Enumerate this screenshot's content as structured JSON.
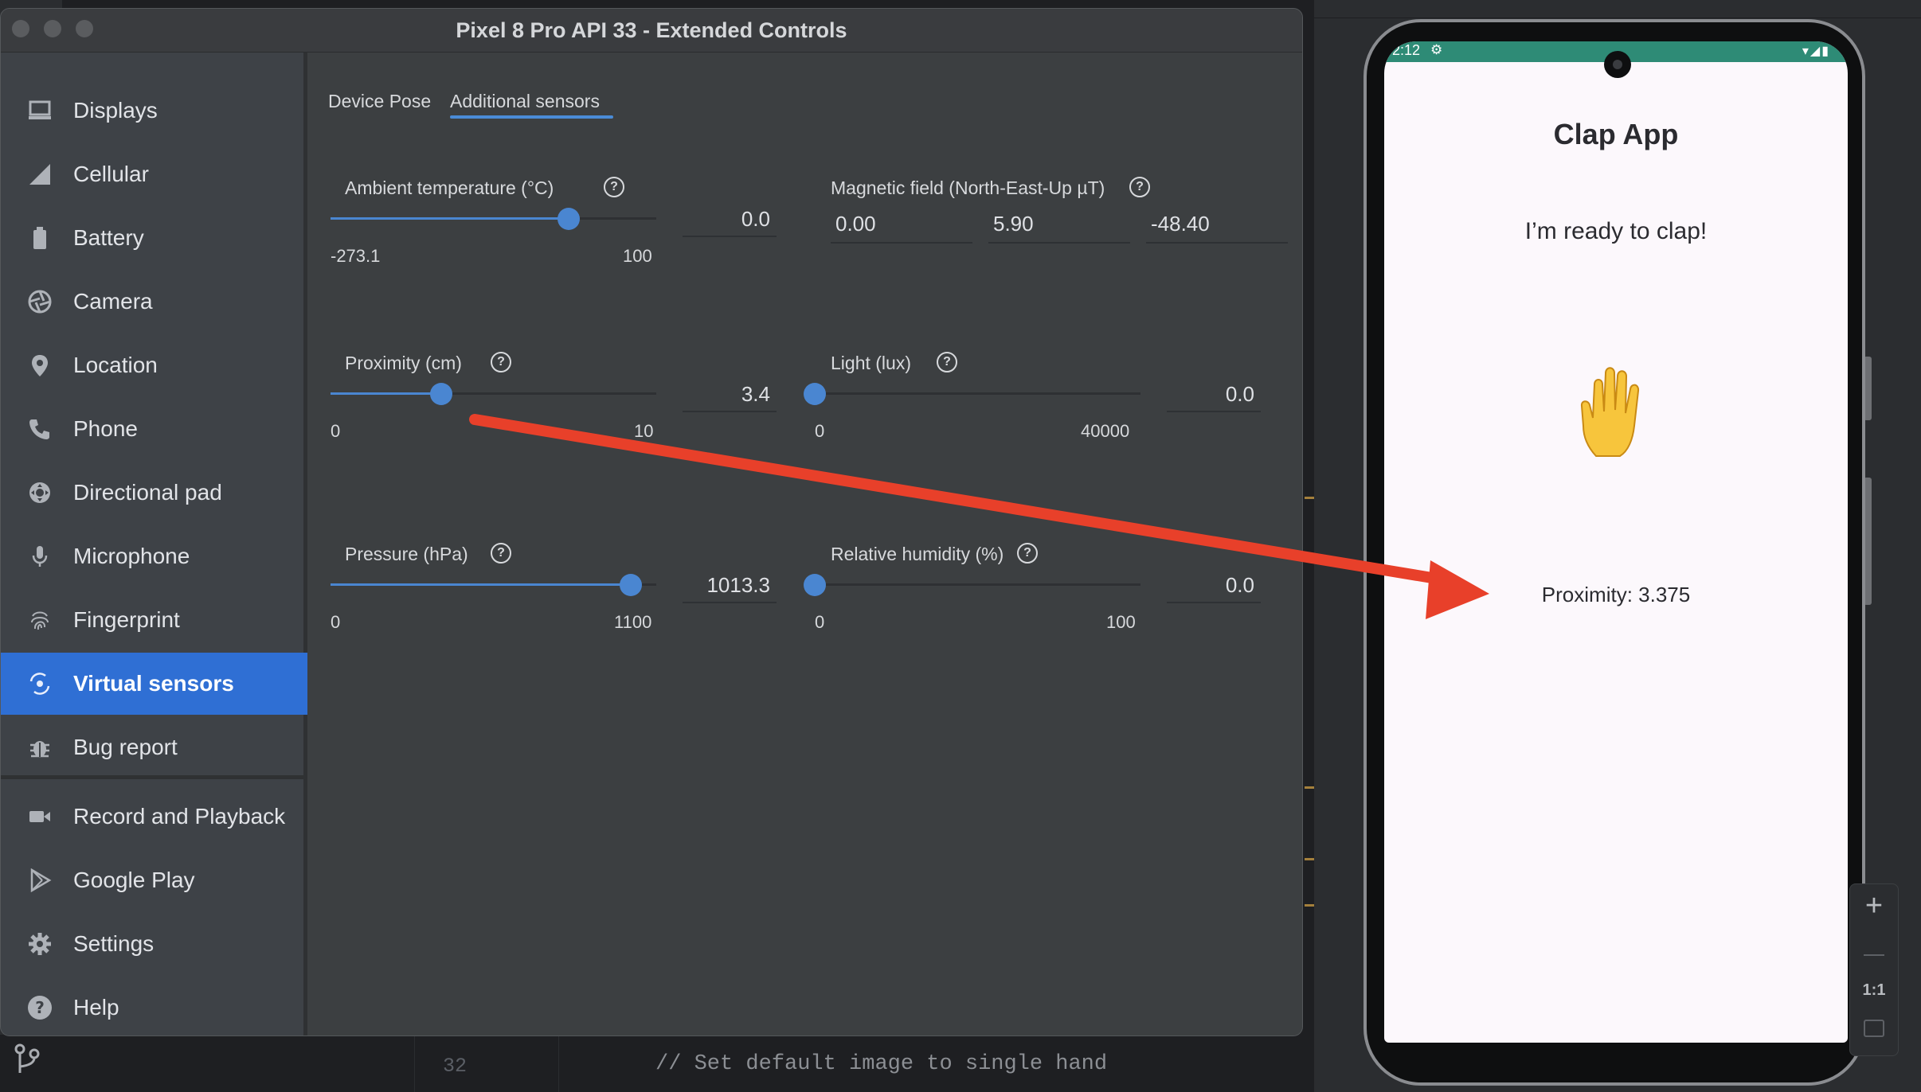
{
  "window": {
    "title": "Pixel 8 Pro API 33 - Extended Controls"
  },
  "sidebar": {
    "items": [
      {
        "label": "Displays",
        "icon": "monitor-icon"
      },
      {
        "label": "Cellular",
        "icon": "cellular-signal-icon"
      },
      {
        "label": "Battery",
        "icon": "battery-icon"
      },
      {
        "label": "Camera",
        "icon": "camera-aperture-icon"
      },
      {
        "label": "Location",
        "icon": "location-pin-icon"
      },
      {
        "label": "Phone",
        "icon": "phone-icon"
      },
      {
        "label": "Directional pad",
        "icon": "dpad-icon"
      },
      {
        "label": "Microphone",
        "icon": "microphone-icon"
      },
      {
        "label": "Fingerprint",
        "icon": "fingerprint-icon"
      },
      {
        "label": "Virtual sensors",
        "icon": "virtual-sensors-icon",
        "selected": true
      },
      {
        "label": "Bug report",
        "icon": "bug-icon"
      },
      {
        "label": "Record and Playback",
        "icon": "video-camera-icon"
      },
      {
        "label": "Google Play",
        "icon": "play-store-icon"
      },
      {
        "label": "Settings",
        "icon": "gear-icon"
      },
      {
        "label": "Help",
        "icon": "help-icon"
      }
    ]
  },
  "tabs": [
    {
      "label": "Device Pose",
      "selected": false
    },
    {
      "label": "Additional sensors",
      "selected": true
    }
  ],
  "sensors": {
    "ambient_temperature": {
      "label": "Ambient temperature (°C)",
      "min": "-273.1",
      "max": "100",
      "value": "0.0",
      "fraction": 0.732
    },
    "magnetic_field": {
      "label": "Magnetic field (North-East-Up µT)",
      "x": "0.00",
      "y": "5.90",
      "z": "-48.40"
    },
    "proximity": {
      "label": "Proximity (cm)",
      "min": "0",
      "max": "10",
      "value": "3.4",
      "fraction": 0.34
    },
    "light": {
      "label": "Light (lux)",
      "min": "0",
      "max": "40000",
      "value": "0.0",
      "fraction": 0.0
    },
    "pressure": {
      "label": "Pressure (hPa)",
      "min": "0",
      "max": "1100",
      "value": "1013.3",
      "fraction": 0.921
    },
    "relative_humidity": {
      "label": "Relative humidity (%)",
      "min": "0",
      "max": "100",
      "value": "0.0",
      "fraction": 0.0
    }
  },
  "phone": {
    "status_time": "2:12",
    "app_title": "Clap App",
    "message": "I’m ready to clap!",
    "hand_icon": "raised-hand-icon",
    "proximity_text": "Proximity: 3.375"
  },
  "editor": {
    "line_number": "32",
    "code": "// Set default image to single hand"
  },
  "emulator_toolbar": {
    "zoom_in": "+",
    "zoom_reset": "1:1"
  },
  "colors": {
    "accent": "#4a86d1",
    "selected_nav": "#2f6fd4",
    "arrow": "#e8402a",
    "status_bar": "#2e8b76"
  }
}
